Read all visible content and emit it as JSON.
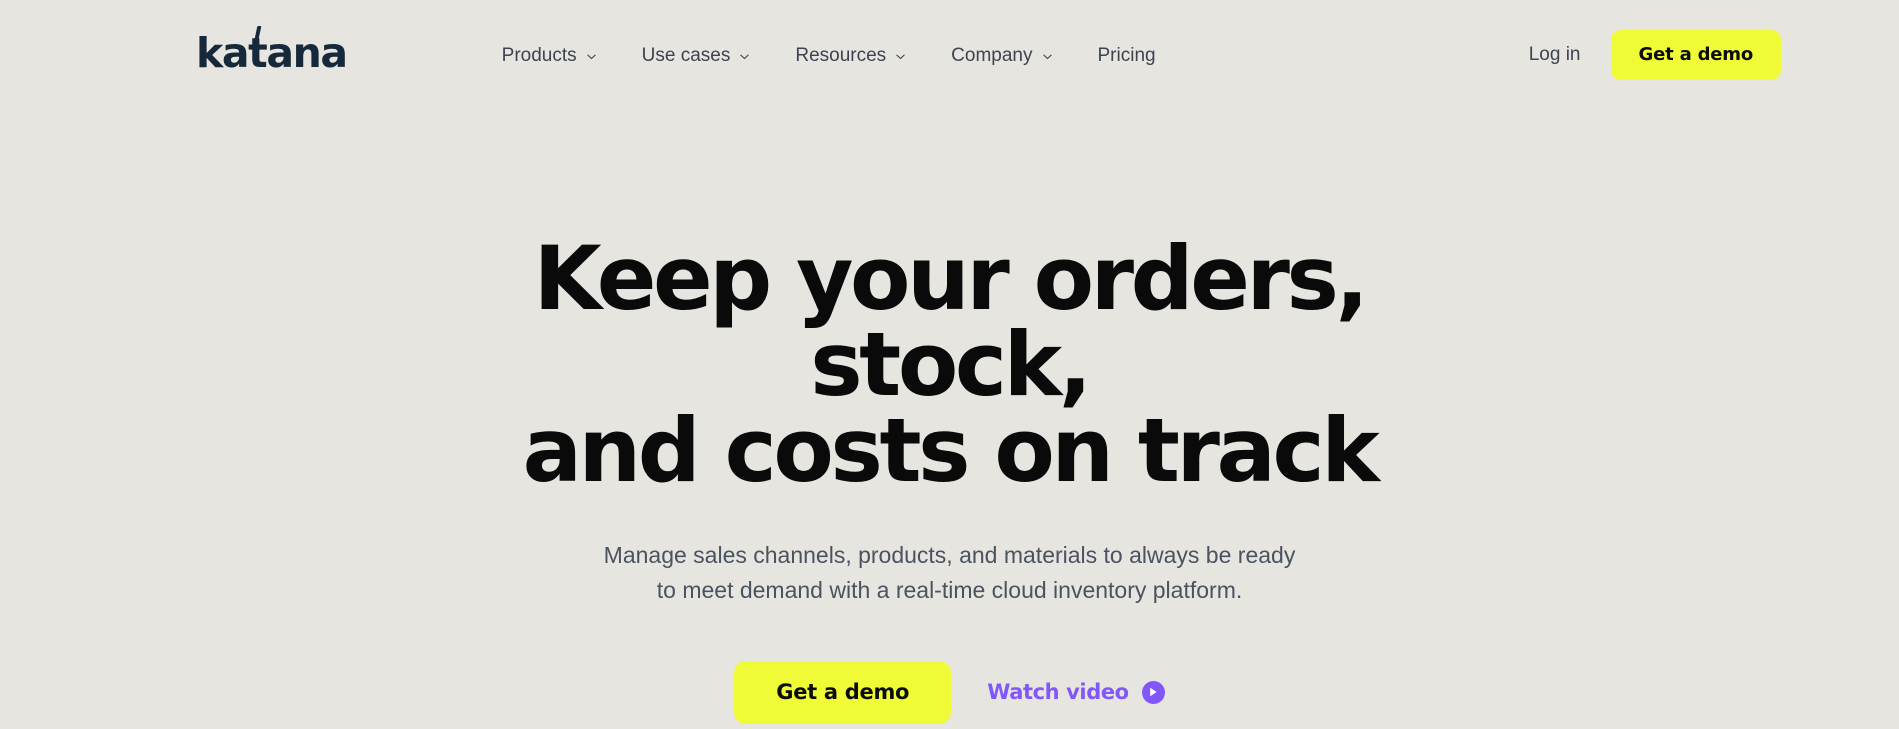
{
  "theme": {
    "background": "#e7e5e0",
    "accent_yellow": "#eefb36",
    "accent_purple": "#8257fa",
    "logo_navy": "#15293b",
    "heading_black": "#0a0a0a",
    "body_gray": "#4b5260"
  },
  "header": {
    "logo": "katana",
    "nav": [
      {
        "label": "Products",
        "has_dropdown": true,
        "icon": "chevron-down-icon"
      },
      {
        "label": "Use cases",
        "has_dropdown": true,
        "icon": "chevron-down-icon"
      },
      {
        "label": "Resources",
        "has_dropdown": true,
        "icon": "chevron-down-icon"
      },
      {
        "label": "Company",
        "has_dropdown": true,
        "icon": "chevron-down-icon"
      },
      {
        "label": "Pricing",
        "has_dropdown": false,
        "icon": ""
      }
    ],
    "login_label": "Log in",
    "demo_button_label": "Get a demo"
  },
  "hero": {
    "title_line_1": "Keep your orders, stock,",
    "title_line_2": "and costs on track",
    "subtitle_line_1": "Manage sales channels, products, and materials to always be ready",
    "subtitle_line_2": "to meet demand with a real-time cloud inventory platform.",
    "primary_cta_label": "Get a demo",
    "secondary_cta_label": "Watch video",
    "secondary_cta_icon": "play-circle-icon"
  }
}
